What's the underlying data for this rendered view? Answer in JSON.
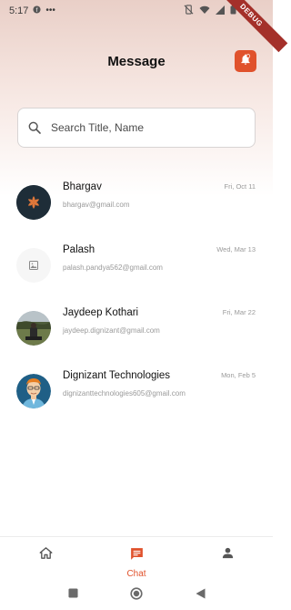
{
  "status_bar": {
    "time": "5:17",
    "left_icons": [
      "notification-f-icon",
      "more-dots-icon"
    ],
    "right_icons": [
      "vibrate-off-icon",
      "wifi-icon",
      "signal-icon",
      "battery-icon"
    ]
  },
  "debug_banner": "DEBUG",
  "header": {
    "title": "Message",
    "notification_icon": "bell-icon",
    "accent_color": "#e0522c"
  },
  "search": {
    "placeholder": "Search Title, Name",
    "icon": "search-icon"
  },
  "chats": [
    {
      "name": "Bhargav",
      "email": "bhargav@gmail.com",
      "date": "Fri, Oct 11",
      "avatar": "logo-dark-avatar"
    },
    {
      "name": "Palash",
      "email": "palash.pandya562@gmail.com",
      "date": "Wed, Mar 13",
      "avatar": "image-placeholder-avatar"
    },
    {
      "name": "Jaydeep Kothari",
      "email": "jaydeep.dignizant@gmail.com",
      "date": "Fri, Mar 22",
      "avatar": "photo-avatar"
    },
    {
      "name": "Dignizant Technologies",
      "email": "dignizanttechnologies605@gmail.com",
      "date": "Mon, Feb 5",
      "avatar": "cartoon-person-avatar"
    }
  ],
  "bottom_nav": {
    "items": [
      {
        "icon": "home-icon",
        "label": ""
      },
      {
        "icon": "chat-icon",
        "label": "Chat",
        "active": true
      },
      {
        "icon": "person-icon",
        "label": ""
      }
    ]
  },
  "system_nav": [
    "square-icon",
    "circle-icon",
    "back-triangle-icon"
  ]
}
